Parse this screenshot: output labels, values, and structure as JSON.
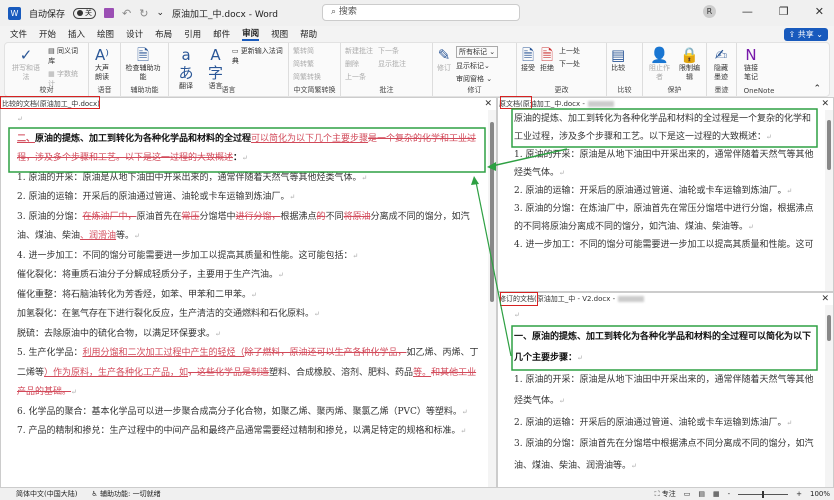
{
  "titlebar": {
    "autosave_label": "自动保存",
    "autosave_state": "关",
    "title": "原油加工_中.docx - Word",
    "search_placeholder": "搜索",
    "avatar": "R",
    "minimize": "—",
    "restore": "❐",
    "close": "✕"
  },
  "menu": [
    "文件",
    "开始",
    "插入",
    "绘图",
    "设计",
    "布局",
    "引用",
    "邮件",
    "审阅",
    "视图",
    "帮助"
  ],
  "share": "共享",
  "ribbon": {
    "proof": {
      "label": "校对",
      "spell": "拼写和语法",
      "thesaurus": "同义词库",
      "wordcount": "字数统计"
    },
    "speech": {
      "label": "语音",
      "read": "大声朗读"
    },
    "access": {
      "label": "辅助功能",
      "check": "检查辅助功能"
    },
    "lang": {
      "label": "语言",
      "translate": "翻译",
      "language": "语言",
      "ime": "更新输入法词典"
    },
    "chinese": {
      "label": "中文简繁转换",
      "t2s": "繁转简",
      "s2t": "简转繁",
      "convert": "简繁转换"
    },
    "comments": {
      "label": "批注",
      "new": "新建批注",
      "delete": "删除",
      "prev": "上一条",
      "next": "下一条",
      "show": "显示批注"
    },
    "track": {
      "label": "修订",
      "track": "修订",
      "markup": "所有标记",
      "showmarkup": "显示标记",
      "pane": "审阅窗格"
    },
    "changes": {
      "label": "更改",
      "accept": "接受",
      "reject": "拒绝",
      "prev": "上一处",
      "next": "下一处"
    },
    "compare": {
      "label": "比较",
      "compare": "比较"
    },
    "protect": {
      "label": "保护",
      "block": "阻止作者",
      "restrict": "限制编辑"
    },
    "ink": {
      "label": "墨迹",
      "hide": "隐藏墨迹"
    },
    "onenote": {
      "label": "OneNote",
      "link": "链接笔记"
    }
  },
  "left_pane": {
    "title": "比较的文档(原油加工_中.docx)",
    "close": "✕",
    "paras": [
      [
        {
          "t": "↵",
          "k": "mk"
        }
      ],
      [
        {
          "t": "二、",
          "k": "ins b"
        },
        {
          "t": "原油的提炼、加工到转化为各种化学品和材料的全过程",
          "k": "b"
        },
        {
          "t": "可以简化为以下几个主要步骤",
          "k": "ins"
        },
        {
          "t": "是一个复杂的化学和工业过程，涉及多个步骤和工艺。以下是这一过程的大致概述",
          "k": "del"
        },
        {
          "t": "：",
          "k": "b"
        },
        {
          "t": "↵",
          "k": "mk"
        }
      ],
      [
        {
          "t": "1.  原油的开采：原油是从地下油田中开采出来的，通常伴随着天然气等其他烃类气体。",
          "k": ""
        },
        {
          "t": "↵",
          "k": "mk"
        }
      ],
      [
        {
          "t": "2.  原油的运输：开采后的原油通过管道、油轮或卡车运输到炼油厂。",
          "k": ""
        },
        {
          "t": "↵",
          "k": "mk"
        }
      ],
      [
        {
          "t": "3.  原油的分馏：",
          "k": ""
        },
        {
          "t": "在炼油厂中，",
          "k": "del"
        },
        {
          "t": "原油首先在",
          "k": ""
        },
        {
          "t": "常压",
          "k": "del"
        },
        {
          "t": "分馏塔中",
          "k": ""
        },
        {
          "t": "进行分馏，",
          "k": "del"
        },
        {
          "t": "根据沸点",
          "k": ""
        },
        {
          "t": "的",
          "k": "del"
        },
        {
          "t": "不同",
          "k": ""
        },
        {
          "t": "将原油",
          "k": "del"
        },
        {
          "t": "分离成不同的馏分，如汽油、煤油、柴油",
          "k": ""
        },
        {
          "t": "、润滑油",
          "k": "ins"
        },
        {
          "t": "等。",
          "k": ""
        },
        {
          "t": "↵",
          "k": "mk"
        }
      ],
      [
        {
          "t": "4.  进一步加工：不同的馏分可能需要进一步加工以提高其质量和性能。这可能包括：",
          "k": ""
        },
        {
          "t": "↵",
          "k": "mk"
        }
      ],
      [
        {
          "t": "催化裂化：将重质石油分子分解成轻质分子，主要用于生产汽油。",
          "k": ""
        },
        {
          "t": "↵",
          "k": "mk"
        }
      ],
      [
        {
          "t": "催化重整：将石脑油转化为芳香烃，如苯、甲苯和二甲苯。",
          "k": ""
        },
        {
          "t": "↵",
          "k": "mk"
        }
      ],
      [
        {
          "t": "加氢裂化：在氢气存在下进行裂化反应，生产清洁的交通燃料和石化原料。",
          "k": ""
        },
        {
          "t": "↵",
          "k": "mk"
        }
      ],
      [
        {
          "t": "脱硫：去除原油中的硫化合物，以满足环保要求。",
          "k": ""
        },
        {
          "t": "↵",
          "k": "mk"
        }
      ],
      [
        {
          "t": "5.  生产化学品：",
          "k": ""
        },
        {
          "t": "利用分馏和二次加工过程中产生的轻烃（",
          "k": "ins"
        },
        {
          "t": "除了燃料，原油还可以生产各种化学品，",
          "k": "del"
        },
        {
          "t": "如乙烯、丙烯、丁二烯等",
          "k": ""
        },
        {
          "t": "）作为原料，生产各种化工产品，如",
          "k": "ins"
        },
        {
          "t": "，这些化学品是制造",
          "k": "del"
        },
        {
          "t": "塑料、合成橡胶、溶剂、肥料、药品",
          "k": ""
        },
        {
          "t": "等。",
          "k": "ins"
        },
        {
          "t": "和其他工业产品的基础。",
          "k": "del"
        },
        {
          "t": "↵",
          "k": "mk"
        }
      ],
      [
        {
          "t": "6.  化学品的聚合：基本化学品可以进一步聚合成高分子化合物，如聚乙烯、聚丙烯、聚氯乙烯（PVC）等塑料。",
          "k": ""
        },
        {
          "t": "↵",
          "k": "mk"
        }
      ],
      [
        {
          "t": "7.  产品的精制和掺兑：生产过程中的中间产品和最终产品通常需要经过精制和掺兑，以满足特定的规格和标准。",
          "k": ""
        },
        {
          "t": "↵",
          "k": "mk"
        }
      ]
    ]
  },
  "orig_pane": {
    "title": "原文档(原油加工_中.docx -",
    "close": "✕",
    "paras": [
      [
        {
          "t": "原油的提炼、加工到转化为各种化学品和材料的全过程是一个复杂的化学和工业过程，涉及多个步骤和工艺。以下是这一过程的大致概述：",
          "k": ""
        },
        {
          "t": "↵",
          "k": "mk"
        }
      ],
      [
        {
          "t": "1.  原油的开采：原油是从地下油田中开采出来的，通常伴随着天然气等其他烃类气体。",
          "k": ""
        },
        {
          "t": "↵",
          "k": "mk"
        }
      ],
      [
        {
          "t": "2.  原油的运输：开采后的原油通过管道、油轮或卡车运输到炼油厂。",
          "k": ""
        },
        {
          "t": "↵",
          "k": "mk"
        }
      ],
      [
        {
          "t": "3.  原油的分馏：在炼油厂中，原油首先在常压分馏塔中进行分馏，根据沸点的不同将原油分离成不同的馏分，如汽油、煤油、柴油等。",
          "k": ""
        },
        {
          "t": "↵",
          "k": "mk"
        }
      ],
      [
        {
          "t": "4.  进一步加工：不同的馏分可能需要进一步加工以提高其质量和性能。这可",
          "k": ""
        }
      ]
    ]
  },
  "rev_pane": {
    "title": "修订的文档(原油加工_中 - V2.docx -",
    "close": "✕",
    "paras": [
      [
        {
          "t": "↵",
          "k": "mk"
        }
      ],
      [
        {
          "t": "一、原油的提炼、加工到转化为各种化学品和材料的全过程可以简化为以下几个主要步骤：",
          "k": "b"
        },
        {
          "t": "↵",
          "k": "mk"
        }
      ],
      [
        {
          "t": "1.  原油的开采：原油是从地下油田中开采出来的，通常伴随着天然气等其他烃类气体。",
          "k": ""
        },
        {
          "t": "↵",
          "k": "mk"
        }
      ],
      [
        {
          "t": "2.  原油的运输：开采后的原油通过管道、油轮或卡车运输到炼油厂。",
          "k": ""
        },
        {
          "t": "↵",
          "k": "mk"
        }
      ],
      [
        {
          "t": "3.  原油的分馏：原油首先在分馏塔中根据沸点不同分离成不同的馏分，如汽油、煤油、柴油、润滑油等。",
          "k": ""
        },
        {
          "t": "↵",
          "k": "mk"
        }
      ]
    ]
  },
  "status": {
    "language": "简体中文(中国大陆)",
    "accessibility": "辅助功能: 一切就绪",
    "focus": "专注",
    "zoom": "100%"
  },
  "colors": {
    "accent": "#185abd",
    "highlight_box": "#2ea043",
    "label_box": "#d62222",
    "revision": "#d24a5a"
  }
}
